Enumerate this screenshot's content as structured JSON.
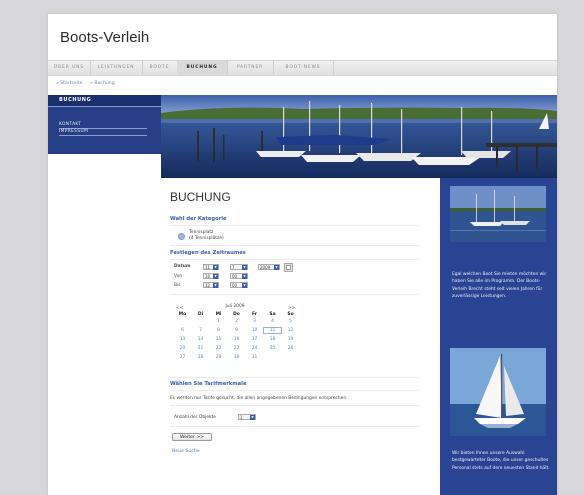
{
  "site": {
    "title": "Boots-Verleih"
  },
  "nav": {
    "items": [
      {
        "label": "ÜBER UNS"
      },
      {
        "label": "LEISTUNGEN"
      },
      {
        "label": "BOOTE"
      },
      {
        "label": "BUCHUNG"
      },
      {
        "label": "PARTNER"
      },
      {
        "label": "BOOT-NEWS"
      }
    ],
    "active_index": 3
  },
  "breadcrumb": {
    "items": [
      "» Startseite",
      "» Buchung"
    ]
  },
  "sidebar": {
    "heading": "BUCHUNG",
    "links": [
      "KONTAKT",
      "IMPRESSUM"
    ]
  },
  "booking": {
    "title": "BUCHUNG",
    "category": {
      "heading": "Wahl der Kategorie",
      "option_line1": "Tennisplatz",
      "option_line2": "(4 Tennisplätze)"
    },
    "period": {
      "heading": "Festlegen des Zeitraumes",
      "datum_label": "Datum",
      "von_label": "Von",
      "bis_label": "Bis",
      "datum_day": "11",
      "datum_month": "7",
      "datum_year": "2009",
      "von_hour": "10",
      "von_minute": "00",
      "bis_hour": "12",
      "bis_minute": "00"
    },
    "calendar": {
      "prev": "<<",
      "next": ">>",
      "month_label": "Juli 2009",
      "weekdays": [
        "Mo",
        "Di",
        "Mi",
        "Do",
        "Fr",
        "Sa",
        "So"
      ],
      "rows": [
        [
          "",
          "",
          "1",
          "2",
          "3",
          "4",
          "5"
        ],
        [
          "6",
          "7",
          "8",
          "9",
          "10",
          "11",
          "12"
        ],
        [
          "13",
          "14",
          "15",
          "16",
          "17",
          "18",
          "19"
        ],
        [
          "20",
          "21",
          "22",
          "23",
          "24",
          "25",
          "26"
        ],
        [
          "27",
          "28",
          "29",
          "30",
          "31",
          "",
          ""
        ]
      ],
      "selected_day": "11"
    },
    "tariff": {
      "heading": "Wählen Sie Tarifmerkmale",
      "description": "Es werden nur Tarife gesucht, die allen angegebenen Bedingungen entsprechen.",
      "count_label": "Anzahl der Objekte",
      "count_value": "1"
    },
    "next_button": "Weiter >>",
    "new_search": "Neue Suche"
  },
  "right_panel": {
    "text1": "Egal welchen Boot Sie mieten möchten wir haben Sie alle im Programm. Der Boots-Verleih Brecht steht seit vielen Jahren für zuverlässige Leistungen.",
    "text2": "Wir bieten Ihnen unsere Auswahl bestgewarteter Boote, die unser geschultes Personal stets auf dem neuesten Stand hält."
  },
  "colors": {
    "accent_blue": "#294492",
    "link_blue": "#5b81c0",
    "heading_blue": "#3a61a5"
  }
}
